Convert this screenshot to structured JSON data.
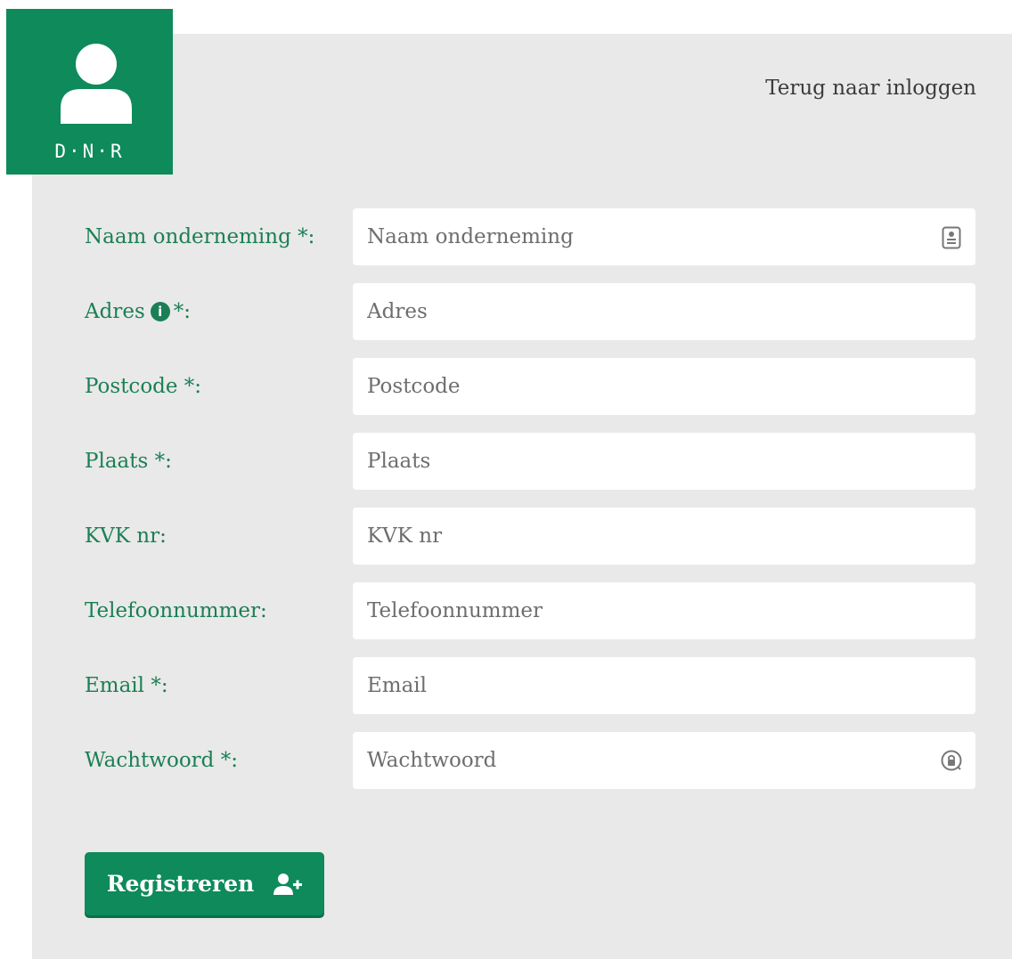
{
  "logo": {
    "text": "D·N·R",
    "icon": "user-icon"
  },
  "nav": {
    "back_link": "Terug naar inloggen"
  },
  "form": {
    "fields": [
      {
        "label": "Naam onderneming *:",
        "placeholder": "Naam onderneming",
        "icon": "contact-card-icon"
      },
      {
        "label": "Adres",
        "label_suffix": "*:",
        "info": "i",
        "placeholder": "Adres"
      },
      {
        "label": "Postcode *:",
        "placeholder": "Postcode"
      },
      {
        "label": "Plaats *:",
        "placeholder": "Plaats"
      },
      {
        "label": "KVK nr:",
        "placeholder": "KVK nr"
      },
      {
        "label": "Telefoonnummer:",
        "placeholder": "Telefoonnummer"
      },
      {
        "label": "Email *:",
        "placeholder": "Email"
      },
      {
        "label": "Wachtwoord *:",
        "placeholder": "Wachtwoord",
        "icon": "password-manager-icon"
      }
    ],
    "submit_label": "Registreren",
    "submit_icon": "user-plus-icon"
  },
  "colors": {
    "brand": "#0e8a5b",
    "label": "#1b7f55",
    "panel": "#e9e9e9"
  }
}
